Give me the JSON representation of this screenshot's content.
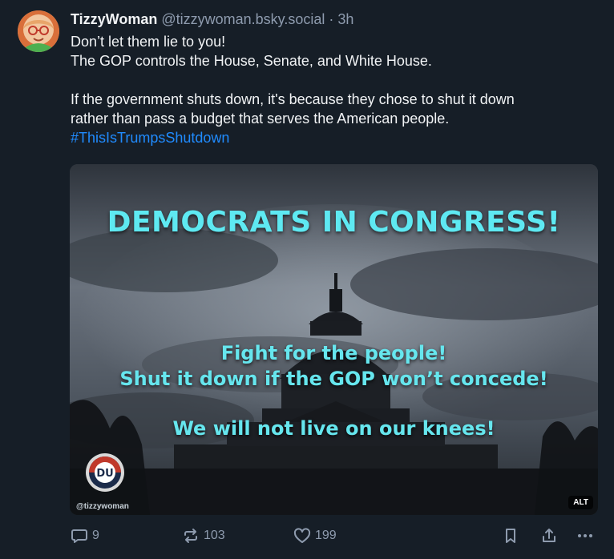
{
  "author": {
    "display_name": "TizzyWoman",
    "handle": "@tizzywoman.bsky.social",
    "separator": "·",
    "time": "3h"
  },
  "post": {
    "lines": [
      "Don’t let them lie to you!",
      "The GOP controls the House, Senate, and White House.",
      "If the government shuts down, it's because they chose to shut it down",
      "rather than pass a budget that serves the American people."
    ],
    "hashtag": "#ThisIsTrumpsShutdown"
  },
  "image": {
    "headline": "DEMOCRATS IN CONGRESS!",
    "line1": "Fight for the people!",
    "line2": "Shut it down if the GOP won’t concede!",
    "line3": "We will not live on our knees!",
    "logo_text": "DU",
    "watermark": "@tizzywoman",
    "alt_badge": "ALT"
  },
  "actions": {
    "reply_count": "9",
    "repost_count": "103",
    "like_count": "199"
  },
  "icons": {
    "reply": "reply-icon",
    "repost": "repost-icon",
    "like": "heart-icon",
    "bookmark": "bookmark-icon",
    "share": "share-icon",
    "more": "more-icon"
  },
  "colors": {
    "background": "#161e27",
    "text": "#f1f3f5",
    "muted": "#8e9bae",
    "hashtag": "#208bfe",
    "meme_text": "#5ee9f2"
  }
}
